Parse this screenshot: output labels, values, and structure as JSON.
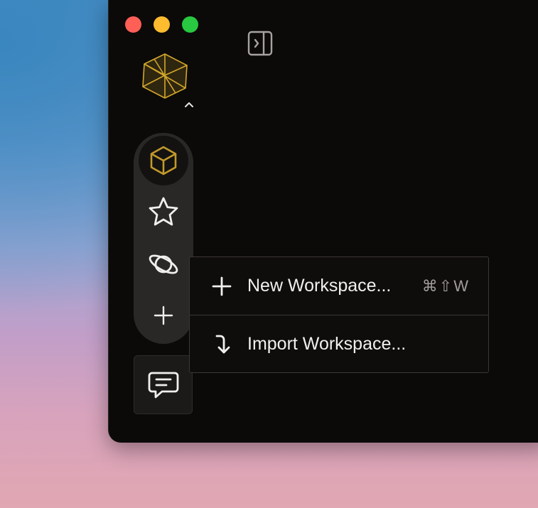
{
  "window_controls": {
    "close": "close-button",
    "minimize": "minimize-button",
    "maximize": "maximize-button"
  },
  "sidebar_toggle": {
    "icon": "sidebar-toggle-icon"
  },
  "logo": {
    "icon": "cube-logo-icon",
    "accent": "#d4a72c"
  },
  "workspace_switcher": {
    "icon": "chevron-up-icon"
  },
  "rail": {
    "items": [
      {
        "icon": "cube-workspace-icon",
        "selected": true
      },
      {
        "icon": "star-icon"
      },
      {
        "icon": "planet-icon"
      },
      {
        "icon": "plus-icon"
      }
    ]
  },
  "chat": {
    "icon": "chat-bubble-icon"
  },
  "menu": {
    "items": [
      {
        "label": "New Workspace...",
        "icon": "plus-icon",
        "shortcut": "⌘⇧W"
      },
      {
        "label": "Import Workspace...",
        "icon": "import-arrow-icon",
        "shortcut": ""
      }
    ]
  }
}
